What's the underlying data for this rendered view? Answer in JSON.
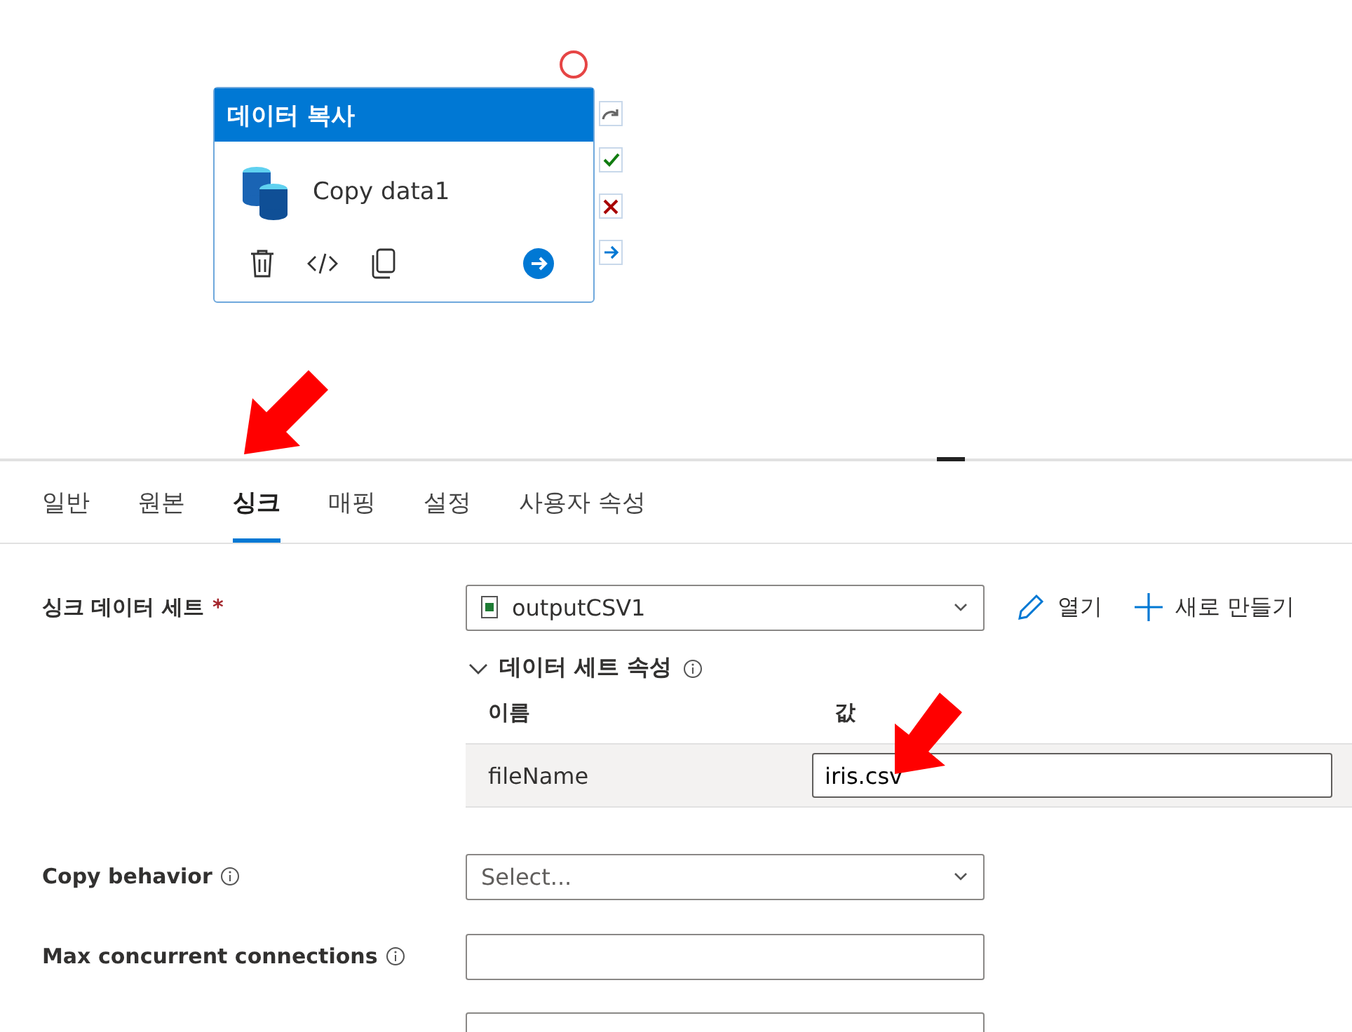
{
  "node": {
    "header": "데이터 복사",
    "name": "Copy data1"
  },
  "tabs": [
    {
      "label": "일반",
      "selected": false
    },
    {
      "label": "원본",
      "selected": false
    },
    {
      "label": "싱크",
      "selected": true
    },
    {
      "label": "매핑",
      "selected": false
    },
    {
      "label": "설정",
      "selected": false
    },
    {
      "label": "사용자 속성",
      "selected": false
    }
  ],
  "sink_dataset": {
    "label": "싱크 데이터 세트",
    "required_mark": "*",
    "value": "outputCSV1",
    "actions": [
      "열기",
      "새로 만들기"
    ]
  },
  "dataset_properties": {
    "title": "데이터 세트 속성",
    "expanded": true,
    "columns": [
      "이름",
      "값"
    ],
    "rows": [
      {
        "name": "fileName",
        "value": "iris.csv"
      }
    ]
  },
  "fields": [
    {
      "kind": "select",
      "label": "Copy behavior",
      "placeholder": "Select..."
    },
    {
      "kind": "text",
      "label": "Max concurrent connections"
    },
    {
      "kind": "text"
    }
  ]
}
